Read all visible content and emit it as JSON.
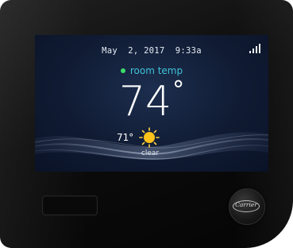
{
  "thermostat": {
    "datetime": "May  2, 2017  9:33a",
    "signal_icon": "signal-strength-icon",
    "signal_bars": 4,
    "room_label": "room temp",
    "room_temp": "74",
    "degree_symbol": "°",
    "outdoor_temp": "71°",
    "weather_icon": "sun-icon",
    "weather_condition": "clear",
    "brand_logo": "Carrier"
  },
  "colors": {
    "screen_background": "#101b33",
    "room_label": "#3fc3d8",
    "status_dot": "#3ddc6a",
    "sun": "#ffc21a",
    "bezel": "#0c0c0c"
  }
}
